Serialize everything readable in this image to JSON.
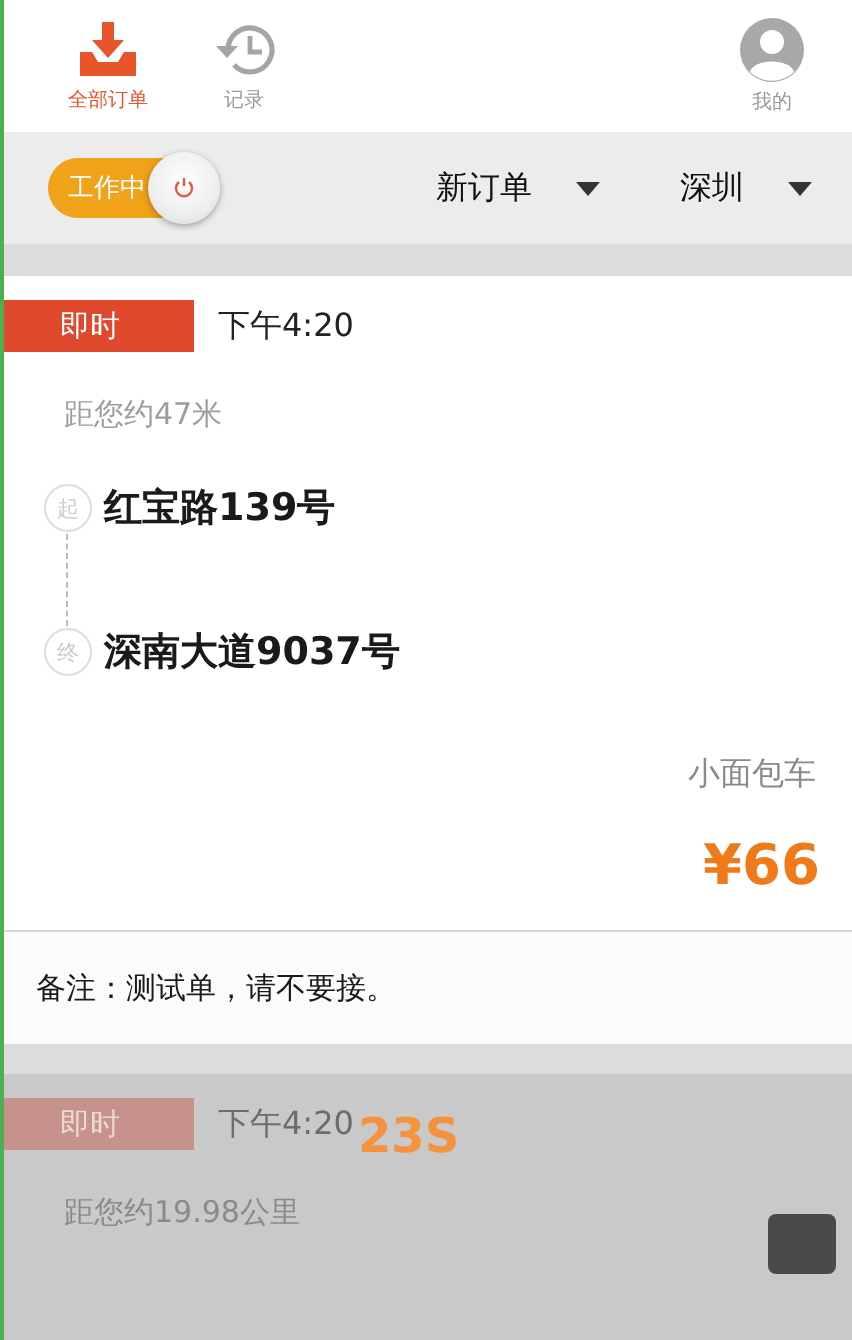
{
  "nav_tabs": [
    {
      "label": "全部订单",
      "kind": "download",
      "selected": true
    },
    {
      "label": "记录",
      "kind": "history",
      "selected": false
    },
    {
      "label": "我的",
      "kind": "avatar",
      "selected": false
    }
  ],
  "work_toggle": {
    "label": "工作中",
    "on": true
  },
  "filters": [
    {
      "label": "新订单"
    },
    {
      "label": "深圳"
    }
  ],
  "orders": [
    {
      "type": "即时",
      "time": "下午4:20",
      "distance": "距您约47米",
      "start_marker": "起",
      "from": "红宝路139号",
      "end_marker": "终",
      "to": "深南大道9037号",
      "vehicle": "小面包车",
      "price": "¥66",
      "remark": "备注：测试单，请不要接。",
      "dimmed": false
    },
    {
      "type": "即时",
      "time": "下午4:20",
      "countdown": "23S",
      "distance": "距您约19.98公里",
      "dimmed": true
    }
  ]
}
